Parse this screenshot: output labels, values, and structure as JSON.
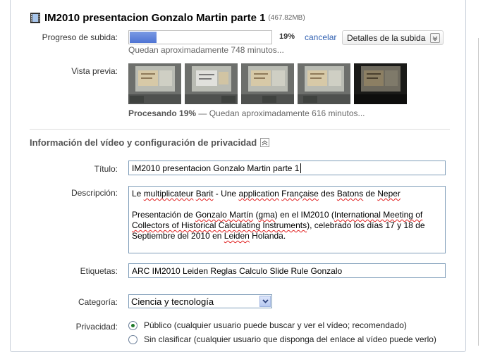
{
  "upload": {
    "title": "IM2010 presentacion Gonzalo Martin parte 1",
    "size": "(467.82MB)",
    "progress_label": "Progreso de subida:",
    "progress_percent": 19,
    "progress_text": "19%",
    "cancel_label": "cancelar",
    "details_label": "Detalles de la subida",
    "remaining": "Quedan aproximadamente 748 minutos..."
  },
  "preview": {
    "label": "Vista previa:",
    "processing_bold": "Procesando 19%",
    "processing_rest": " — Quedan aproximadamente 616 minutos...",
    "thumbnails": [
      "thumbnail-1",
      "thumbnail-2",
      "thumbnail-3",
      "thumbnail-4",
      "thumbnail-5"
    ]
  },
  "section": {
    "title": "Información del vídeo y configuración de privacidad"
  },
  "form": {
    "title_label": "Título:",
    "title_value": "IM2010 presentacion Gonzalo Martin  parte 1",
    "description_label": "Descripción:",
    "description": {
      "line1_a": "Le ",
      "line1_b": "multiplicateur",
      "line1_c": " ",
      "line1_d": "Barit",
      "line1_e": " -  Une ",
      "line1_f": "application",
      "line1_g": " ",
      "line1_h": "Française",
      "line1_i": " des ",
      "line1_j": "Batons",
      "line1_k": " de ",
      "line1_l": "Neper",
      "p2_a": "Presentación de ",
      "p2_b": "Gonzalo Martín",
      "p2_c": " (",
      "p2_d": "gma",
      "p2_e": ") en el IM2010 (",
      "p2_f": "International Meeting of Collectors of Historical Calculating Instruments",
      "p2_g": "), celebrado los días 17 y 18 de Septiembre del 2010 en ",
      "p2_h": "Leiden",
      "p2_i": " Holanda."
    },
    "tags_label": "Etiquetas:",
    "tags_value": "ARC IM2010 Leiden Reglas Calculo Slide Rule Gonzalo",
    "category_label": "Categoría:",
    "category_value": "Ciencia y tecnología",
    "privacy_label": "Privacidad:",
    "privacy_options": [
      {
        "label": "Público (cualquier usuario puede buscar y ver el vídeo; recomendado)",
        "selected": true
      },
      {
        "label": "Sin clasificar (cualquier usuario que disponga del enlace al vídeo puede verlo)",
        "selected": false
      }
    ]
  },
  "colors": {
    "progress": "#5a7fd9",
    "link": "#2f5fb0",
    "radio_selected": "#1e7a2a"
  }
}
